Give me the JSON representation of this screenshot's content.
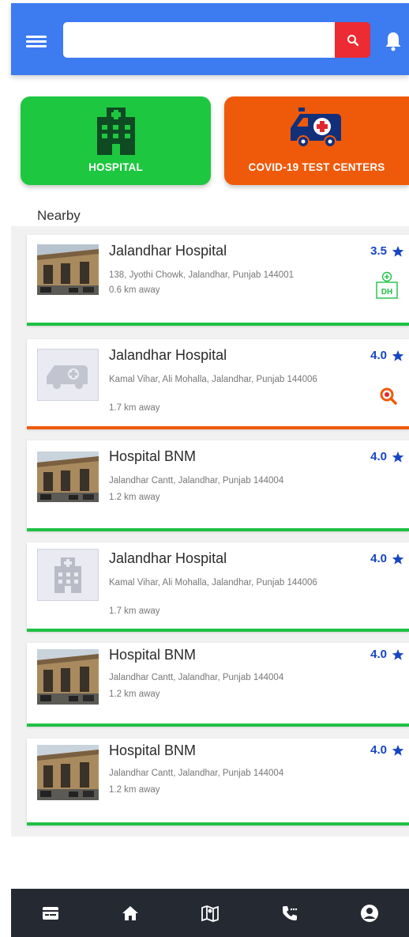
{
  "header": {
    "search_placeholder": "",
    "brand_color": "#3d7bf0",
    "search_button_color": "#ec2b33"
  },
  "categories": [
    {
      "label": "HOSPITAL",
      "icon": "hospital-building-icon",
      "color": "#1ec740"
    },
    {
      "label": "COVID-19 TEST CENTERS",
      "icon": "ambulance-icon",
      "color": "#ef5a0a"
    }
  ],
  "nearby": {
    "title": "Nearby",
    "items": [
      {
        "name": "Jalandhar Hospital",
        "address": "138, Jyothi Chowk, Jalandhar, Punjab 144001",
        "distance": "0.6 km away",
        "rating": "3.5",
        "badge": "DH",
        "badge_icon": "district-hospital-icon",
        "thumb": "hospital-photo",
        "accent": "green"
      },
      {
        "name": "Jalandhar Hospital",
        "address": "Kamal Vihar, Ali Mohalla, Jalandhar, Punjab 144006",
        "distance": "1.7 km away",
        "rating": "4.0",
        "badge_icon": "test-center-search-icon",
        "thumb": "ambulance-placeholder",
        "accent": "orange"
      },
      {
        "name": "Hospital BNM",
        "address": "Jalandhar Cantt, Jalandhar, Punjab 144004",
        "distance": "1.2 km away",
        "rating": "4.0",
        "thumb": "hospital-photo",
        "accent": "green"
      },
      {
        "name": "Jalandhar Hospital",
        "address": "Kamal Vihar, Ali Mohalla, Jalandhar, Punjab 144006",
        "distance": "1.7 km away",
        "rating": "4.0",
        "thumb": "hospital-placeholder",
        "accent": "green"
      },
      {
        "name": "Hospital BNM",
        "address": "Jalandhar Cantt, Jalandhar, Punjab 144004",
        "distance": "1.2 km away",
        "rating": "4.0",
        "thumb": "hospital-photo",
        "accent": "green"
      },
      {
        "name": "Hospital BNM",
        "address": "Jalandhar Cantt, Jalandhar, Punjab 144004",
        "distance": "1.2 km away",
        "rating": "4.0",
        "thumb": "hospital-photo",
        "accent": "green"
      }
    ]
  },
  "bottom_nav": [
    {
      "icon": "id-card-icon"
    },
    {
      "icon": "home-icon"
    },
    {
      "icon": "map-icon"
    },
    {
      "icon": "phone-call-icon"
    },
    {
      "icon": "account-icon"
    }
  ],
  "colors": {
    "green": "#20c045",
    "orange": "#ef5a0a",
    "rating": "#1746c4",
    "nav_bg": "#252932"
  }
}
